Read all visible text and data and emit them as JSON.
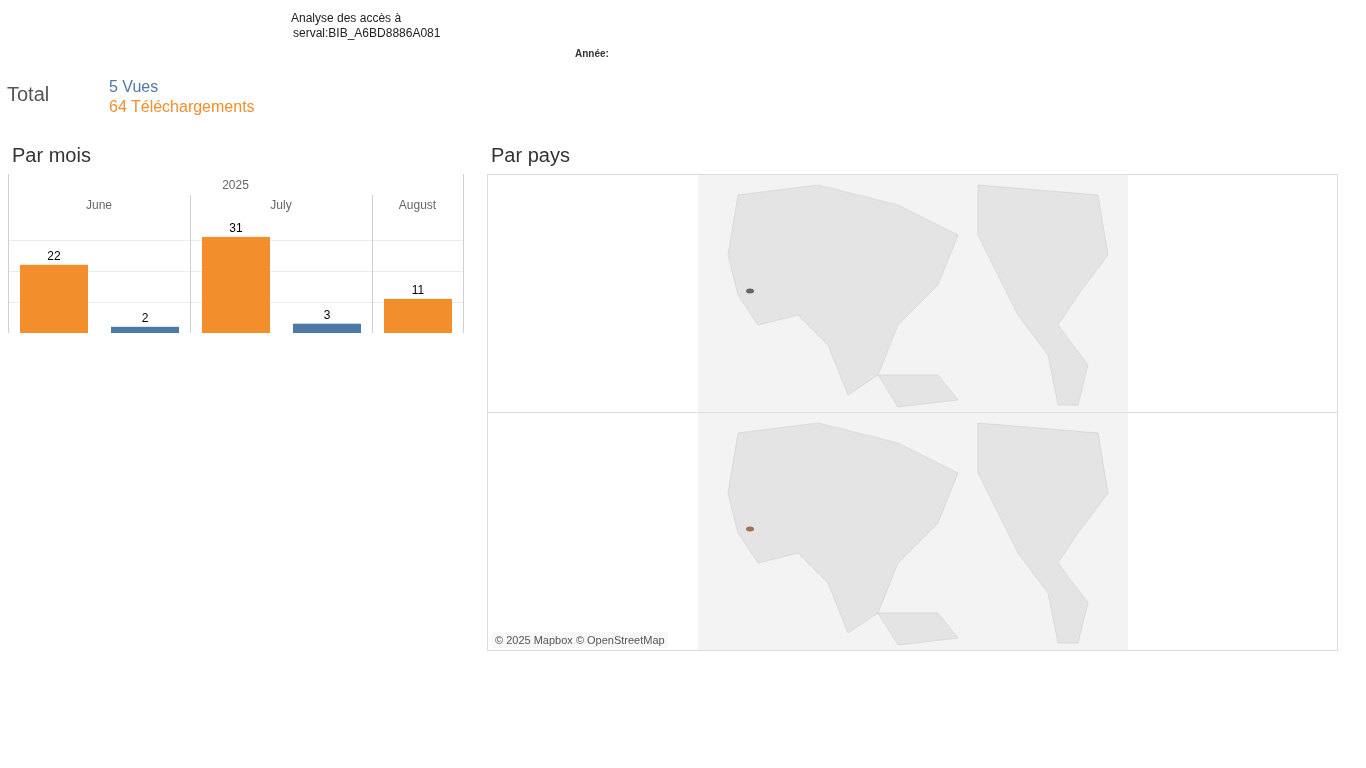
{
  "header": {
    "title": "Analyse des accès à",
    "subtitle": "serval:BIB_A6BD8886A081",
    "filter_label": "Année:"
  },
  "total": {
    "label": "Total",
    "views": "5 Vues",
    "downloads": "64 Téléchargements"
  },
  "by_month": {
    "title": "Par mois",
    "year": "2025",
    "chart_data": {
      "type": "bar",
      "categories": [
        "June",
        "July",
        "August"
      ],
      "series": [
        {
          "color": "#f28e2b",
          "values": [
            22,
            31,
            11
          ]
        },
        {
          "color": "#4e79a7",
          "values": [
            2,
            3,
            null
          ]
        }
      ],
      "data_labels": true
    }
  },
  "by_country": {
    "title": "Par pays",
    "attribution": "© 2025 Mapbox © OpenStreetMap"
  }
}
